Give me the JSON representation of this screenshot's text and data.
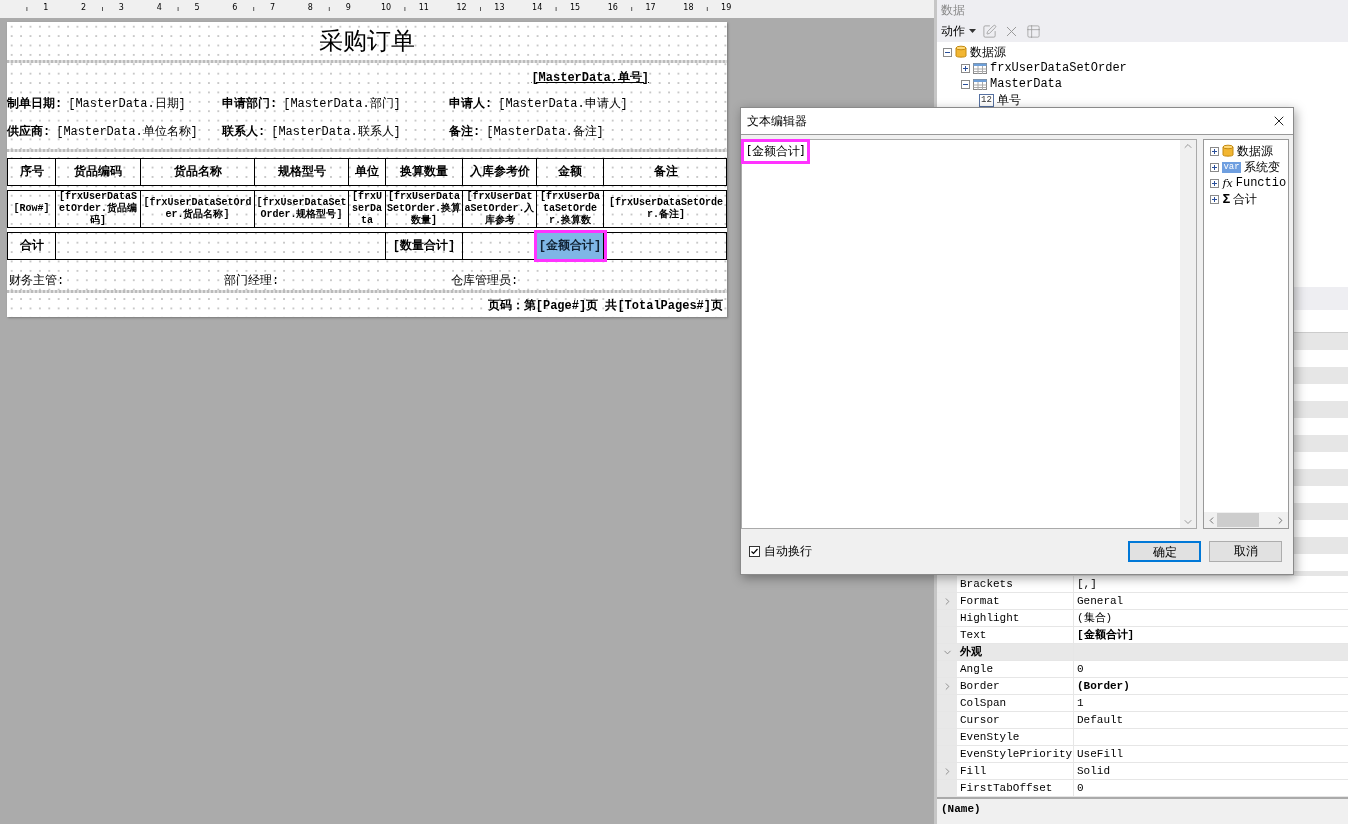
{
  "ruler": {
    "numbers": [
      "1",
      "2",
      "3",
      "4",
      "5",
      "6",
      "7",
      "8",
      "9",
      "10",
      "11",
      "12",
      "13",
      "14",
      "15",
      "16",
      "17",
      "18",
      "19"
    ]
  },
  "report": {
    "title": "采购订单",
    "order_no": "[MasterData.单号]",
    "info_rows": [
      [
        {
          "label": "制单日期:",
          "value": "[MasterData.日期]"
        },
        {
          "label": "申请部门:",
          "value": "[MasterData.部门]"
        },
        {
          "label": "申请人:",
          "value": "[MasterData.申请人]"
        }
      ],
      [
        {
          "label": "供应商:",
          "value": "[MasterData.单位名称]"
        },
        {
          "label": "联系人:",
          "value": "[MasterData.联系人]"
        },
        {
          "label": "备注:",
          "value": "[MasterData.备注]"
        }
      ]
    ],
    "columns": [
      "序号",
      "货品编码",
      "货品名称",
      "规格型号",
      "单位",
      "换算数量",
      "入库参考价",
      "金额",
      "备注"
    ],
    "data_row": [
      "[Row#]",
      "[frxUserDataSetOrder.货品编码]",
      "[frxUserDataSetOrder.货品名称]",
      "[frxUserDataSetOrder.规格型号]",
      "[frxUserData",
      "[frxUserDataSetOrder.换算数量]",
      "[frxUserDataSetOrder.入库参考",
      "[frxUserDataSetOrder.换算数",
      "[frxUserDataSetOrder.备注]"
    ],
    "total_row": [
      {
        "text": "合计",
        "selected": false
      },
      {
        "selected": false
      },
      {
        "text": "[数量合计]",
        "selected": false
      },
      {
        "selected": false
      },
      {
        "text": "[金额合计]",
        "selected": true,
        "highlighted": true
      },
      {
        "selected": false
      }
    ],
    "signatures": [
      "财务主管:",
      "部门经理:",
      "仓库管理员:"
    ],
    "page_footer": "页码：第[Page#]页 共[TotalPages#]页"
  },
  "data_panel": {
    "title": "数据",
    "action": "动作",
    "tree": [
      {
        "label": "数据源",
        "kind": "database",
        "expanded": true,
        "children": [
          {
            "label": "frxUserDataSetOrder",
            "kind": "table",
            "expanded": false
          },
          {
            "label": "MasterData",
            "kind": "table",
            "expanded": true,
            "children": [
              {
                "label": "单号",
                "kind": "field",
                "icon_text": "12"
              }
            ]
          }
        ]
      }
    ]
  },
  "properties": {
    "rows": [
      {
        "kind": "property",
        "name": "Brackets",
        "value": "[,]",
        "expandable": false,
        "bold": false
      },
      {
        "kind": "property",
        "name": "Format",
        "value": "General",
        "expandable": true,
        "bold": false
      },
      {
        "kind": "property",
        "name": "Highlight",
        "value": "(集合)",
        "expandable": false,
        "bold": false
      },
      {
        "kind": "property",
        "name": "Text",
        "value": "[金额合计]",
        "expandable": false,
        "bold": true
      },
      {
        "kind": "category",
        "name": "外观",
        "expanded": true
      },
      {
        "kind": "property",
        "name": "Angle",
        "value": "0",
        "expandable": false,
        "bold": false
      },
      {
        "kind": "property",
        "name": "Border",
        "value": "(Border)",
        "expandable": true,
        "bold": true
      },
      {
        "kind": "property",
        "name": "ColSpan",
        "value": "1",
        "expandable": false,
        "bold": false
      },
      {
        "kind": "property",
        "name": "Cursor",
        "value": "Default",
        "expandable": false,
        "bold": false
      },
      {
        "kind": "property",
        "name": "EvenStyle",
        "expandable": false
      },
      {
        "kind": "property",
        "name": "EvenStylePriority",
        "value": "UseFill",
        "expandable": false,
        "bold": false
      },
      {
        "kind": "property",
        "name": "Fill",
        "value": "Solid",
        "expandable": true,
        "bold": false
      },
      {
        "kind": "property",
        "name": "FirstTabOffset",
        "value": "0",
        "expandable": false,
        "bold": false
      }
    ],
    "description": "(Name)"
  },
  "dialog": {
    "title": "文本编辑器",
    "text": "[金额合计]",
    "text_highlighted": true,
    "tree": [
      {
        "label": "数据源",
        "kind": "database",
        "expanded": false
      },
      {
        "label": "系统变",
        "kind": "variable",
        "icon_text": "var",
        "expanded": false
      },
      {
        "label": "Functio",
        "kind": "function",
        "icon_text": "fx",
        "expanded": false
      },
      {
        "label": "合计",
        "kind": "sum",
        "icon_text": "Σ",
        "expanded": false
      }
    ],
    "word_wrap": {
      "label": "自动换行",
      "checked": true
    },
    "buttons": [
      {
        "label": "确定",
        "default": true
      },
      {
        "label": "取消",
        "default": false
      }
    ]
  }
}
